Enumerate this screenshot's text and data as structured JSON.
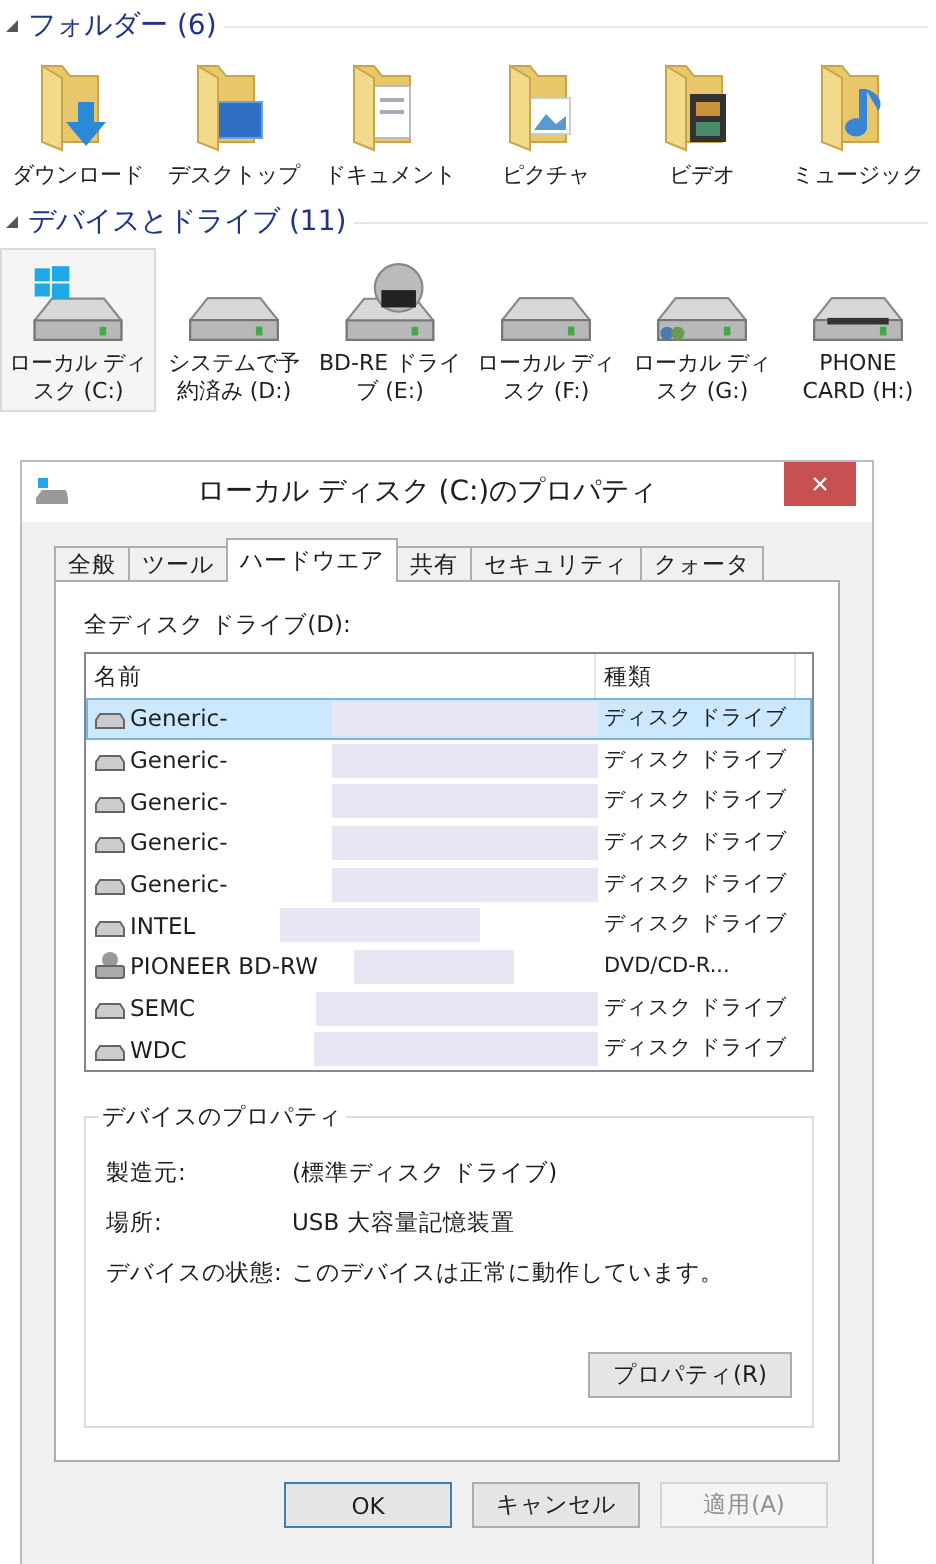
{
  "folders": {
    "label": "フォルダー (6)",
    "expanded": true,
    "items": [
      {
        "label": "ダウンロード",
        "kind": "download"
      },
      {
        "label": "デスクトップ",
        "kind": "desktop"
      },
      {
        "label": "ドキュメント",
        "kind": "document"
      },
      {
        "label": "ピクチャ",
        "kind": "picture"
      },
      {
        "label": "ビデオ",
        "kind": "video"
      },
      {
        "label": "ミュージック",
        "kind": "music"
      }
    ]
  },
  "devices": {
    "label": "デバイスとドライブ (11)",
    "expanded": true,
    "items": [
      {
        "label": "ローカル ディスク (C:)",
        "kind": "windows",
        "selected": true
      },
      {
        "label": "システムで予約済み (D:)",
        "kind": "hdd",
        "selected": false
      },
      {
        "label": "BD-RE ドライブ (E:)",
        "kind": "bd",
        "selected": false
      },
      {
        "label": "ローカル ディスク (F:)",
        "kind": "hdd",
        "selected": false
      },
      {
        "label": "ローカル ディスク (G:)",
        "kind": "shared",
        "selected": false
      },
      {
        "label": "PHONE CARD (H:)",
        "kind": "card",
        "selected": false
      }
    ]
  },
  "dialog": {
    "title": "ローカル ディスク (C:)のプロパティ",
    "close": "×",
    "tabs": [
      {
        "label": "全般",
        "selected": false
      },
      {
        "label": "ツール",
        "selected": false
      },
      {
        "label": "ハードウエア",
        "selected": true
      },
      {
        "label": "共有",
        "selected": false
      },
      {
        "label": "セキュリティ",
        "selected": false
      },
      {
        "label": "クォータ",
        "selected": false
      }
    ],
    "list_label": "全ディスク ドライブ(D):",
    "columns": [
      "名前",
      "種類"
    ],
    "rows": [
      {
        "name": "Generic-",
        "type": "ディスク ドライブ",
        "kind": "disk",
        "selected": true
      },
      {
        "name": "Generic-",
        "type": "ディスク ドライブ",
        "kind": "disk",
        "selected": false
      },
      {
        "name": "Generic-",
        "type": "ディスク ドライブ",
        "kind": "disk",
        "selected": false
      },
      {
        "name": "Generic-",
        "type": "ディスク ドライブ",
        "kind": "disk",
        "selected": false
      },
      {
        "name": "Generic-",
        "type": "ディスク ドライブ",
        "kind": "disk",
        "selected": false
      },
      {
        "name": "INTEL",
        "type": "ディスク ドライブ",
        "kind": "disk",
        "selected": false
      },
      {
        "name": "PIONEER BD-RW",
        "type": "DVD/CD-R...",
        "kind": "optical",
        "selected": false
      },
      {
        "name": "SEMC",
        "type": "ディスク ドライブ",
        "kind": "disk",
        "selected": false
      },
      {
        "name": "WDC",
        "type": "ディスク ドライブ",
        "kind": "disk",
        "selected": false
      }
    ],
    "group_title": "デバイスのプロパティ",
    "properties": [
      {
        "label": "製造元:",
        "value": "(標準ディスク ドライブ)"
      },
      {
        "label": "場所:",
        "value": "USB 大容量記憶装置"
      },
      {
        "label": "デバイスの状態:",
        "value": "このデバイスは正常に動作しています。"
      }
    ],
    "properties_button": "プロパティ(R)",
    "buttons": [
      {
        "label": "OK",
        "kind": "default",
        "disabled": false
      },
      {
        "label": "キャンセル",
        "kind": "normal",
        "disabled": false
      },
      {
        "label": "適用(A)",
        "kind": "normal",
        "disabled": true
      }
    ]
  }
}
